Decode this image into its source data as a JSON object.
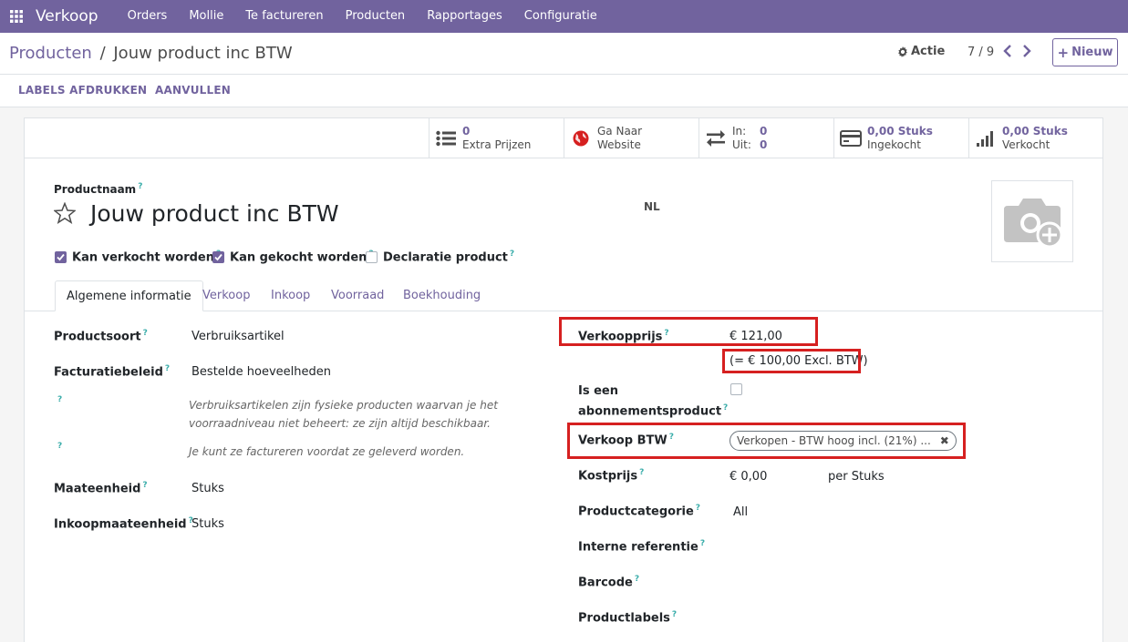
{
  "navbar": {
    "app_name": "Verkoop",
    "menu": [
      "Orders",
      "Mollie",
      "Te factureren",
      "Producten",
      "Rapportages",
      "Configuratie"
    ]
  },
  "breadcrumb": {
    "parent": "Producten",
    "separator": "/",
    "current": "Jouw product inc BTW"
  },
  "control": {
    "action_label": "Actie",
    "pager": "7 / 9",
    "new_label": "Nieuw"
  },
  "actions": {
    "print_labels": "LABELS AFDRUKKEN",
    "replenish": "AANVULLEN"
  },
  "smart_buttons": {
    "extra_prices": {
      "value": "0",
      "label": "Extra Prijzen"
    },
    "website": {
      "line1": "Ga Naar",
      "line2": "Website"
    },
    "inout": {
      "in_label": "In:",
      "in_value": "0",
      "out_label": "Uit:",
      "out_value": "0"
    },
    "purchased": {
      "value": "0,00 Stuks",
      "label": "Ingekocht"
    },
    "sold": {
      "value": "0,00 Stuks",
      "label": "Verkocht"
    }
  },
  "product": {
    "name_label": "Productnaam",
    "name": "Jouw product inc BTW",
    "lang": "NL",
    "can_be_sold": {
      "label": "Kan verkocht worden",
      "checked": true
    },
    "can_be_purchased": {
      "label": "Kan gekocht worden",
      "checked": true
    },
    "expense": {
      "label": "Declaratie product",
      "checked": false
    }
  },
  "tabs": [
    "Algemene informatie",
    "Verkoop",
    "Inkoop",
    "Voorraad",
    "Boekhouding"
  ],
  "left_fields": {
    "type_label": "Productsoort",
    "type_value": "Verbruiksartikel",
    "invoice_policy_label": "Facturatiebeleid",
    "invoice_policy_value": "Bestelde hoeveelheden",
    "hint1_line1": "Verbruiksartikelen zijn fysieke producten waarvan je het",
    "hint1_line2": "voorraadniveau niet beheert: ze zijn altijd beschikbaar.",
    "hint2": "Je kunt ze factureren voordat ze geleverd worden.",
    "uom_label": "Maateenheid",
    "uom_value": "Stuks",
    "purchase_uom_label": "Inkoopmaateenheid",
    "purchase_uom_value": "Stuks"
  },
  "right_fields": {
    "sales_price_label": "Verkoopprijs",
    "sales_price_value": "€ 121,00",
    "excl_tax": "(= € 100,00 Excl. BTW)",
    "subscription_label_1": "Is een",
    "subscription_label_2": "abonnementsproduct",
    "sales_tax_label": "Verkoop BTW",
    "sales_tax_tag": "Verkopen - BTW hoog incl. (21%) ...",
    "cost_label": "Kostprijs",
    "cost_value": "€ 0,00",
    "cost_unit": "per Stuks",
    "category_label": "Productcategorie",
    "category_value": "All",
    "internal_ref_label": "Interne referentie",
    "barcode_label": "Barcode",
    "tags_label": "Productlabels"
  },
  "tooltip_mark": "?",
  "colors": {
    "brand": "#71639e",
    "highlight": "#d62020"
  }
}
